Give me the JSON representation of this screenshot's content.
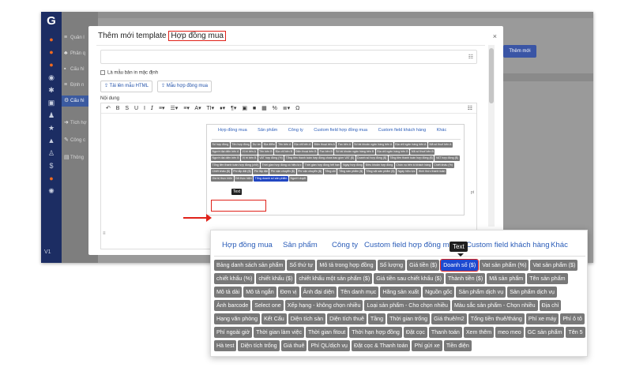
{
  "colors": {
    "accent": "#2146c2",
    "highlight": "#e0221a",
    "chip": "#787878",
    "nav": "#1c2d63"
  },
  "nav": {
    "logo": "G",
    "version": "V1"
  },
  "sidebar": {
    "items": [
      {
        "icon": "≡",
        "label": "Quản l"
      },
      {
        "icon": "♣",
        "label": "Phân q"
      },
      {
        "icon": "▪",
        "label": "Cấu hì"
      },
      {
        "icon": "≡",
        "label": "Định n"
      },
      {
        "icon": "⚙",
        "label": "Cấu hì"
      },
      {
        "icon": "➜",
        "label": "Tích hợ"
      },
      {
        "icon": "✎",
        "label": "Công c"
      },
      {
        "icon": "▤",
        "label": "Thông"
      }
    ]
  },
  "background": {
    "add_button": "Thêm mới"
  },
  "modal": {
    "title_prefix": "Thêm mới template",
    "title_highlight": "Hợp đồng mua",
    "close": "×",
    "checkbox_label": "Là mẫu bản in mặc định",
    "upload_html": "Tải lên mẫu HTML",
    "contract_template": "Mẫu hợp đồng mua",
    "content_label": "Nội dung",
    "toolbar": "↶ B S U I 𝘐 ≡▾ ☰▾ ≡▾ A▾ TI▾ ♦▾ ¶▾ ▣ ■ ▦ % ≣▾ Ω",
    "toolbar_right": "☷",
    "editor_right": "pt"
  },
  "tabs": [
    "Hợp đồng mua",
    "Sản phẩm",
    "Công ty",
    "Custom field hợp đồng mua",
    "Custom field khách hàng",
    "Khác"
  ],
  "small_chips": [
    "Số hợp đồng",
    "Tên hợp đồng",
    "Dự án",
    "Địa điểm",
    "Tên bên A",
    "Địa chỉ bên A",
    "Điện thoại bên A",
    "Fax bên A",
    "Số tài khoản ngân hàng bên A",
    "Địa chỉ ngân hàng bên A",
    "Mã số thuế bên A",
    "Người đại diện bên A",
    "Vị trí bên A",
    "Tên bên B",
    "Địa chỉ bên B",
    "Điện thoại bên B",
    "Fax bên B",
    "Số tài khoản ngân hàng bên B",
    "Địa chỉ ngân hàng bên B",
    "Mã số thuế bên B",
    "Người đại diện bên B",
    "Vị trí bên B",
    "VAT hợp đồng (%)",
    "Tổng tiền thanh toán hợp đồng chưa bao gồm VAT ($)",
    "Doanh số hợp đồng ($)",
    "Tổng tiền thanh toán hợp đồng ($)",
    "VAT hợp đồng ($)",
    "Tổng tiền thanh toán hợp đồng (chữ)",
    "Thời gian hợp đồng có hiệu lực",
    "Thời gian hợp đồng hết hạn",
    "Ngày hợp đồng",
    "Điều khoản hợp đồng",
    "Chức vụ bên kí khách hàng",
    "Chiết khấu (%)",
    "Chiết khấu ($)",
    "Phí lắp đặt ($)",
    "Phí lắp đặt",
    "Phí vận chuyển ($)",
    "Phí vận chuyển ($)",
    "Tổng chi",
    "Tổng sản phẩm ($)",
    "Tổng vật sản phẩm ($)",
    "Ngày hiệu lực",
    "Hình thức thanh toán",
    "Giá trị thực hiện",
    "Đã thực hiện",
    "Tổng doanh số sản phẩm",
    "Người duyệt"
  ],
  "small_tooltip": "Text",
  "zoom_chips": [
    "Bảng danh sách sản phẩm",
    "Số thứ tự",
    "Mô tả trong hợp đồng",
    "Số lượng",
    "Giá tiền ($)",
    "Doanh số ($)",
    "Vat sản phẩm (%)",
    "Vat sản phẩm ($)",
    "chiết khấu (%)",
    "chiết khấu ($)",
    "chiết khấu một sản phẩm ($)",
    "Giá tiền sau chiết khấu ($)",
    "Thành tiền ($)",
    "Mã sản phẩm",
    "Tên sản phẩm",
    "Mô tả dài",
    "Mô tả ngắn",
    "Đơn vị",
    "Ảnh đại diện",
    "Tên danh mục",
    "Hãng sản xuất",
    "Nguồn gốc",
    "Sản phẩm dịch vụ",
    "Sản phẩm dịch vụ",
    "Ảnh barcode",
    "Select one",
    "Xếp hạng - không chọn nhiều",
    "Loại sản phẩm - Cho chọn nhiều",
    "Màu sắc sản phẩm - Chọn nhiều",
    "Địa chỉ",
    "Hạng văn phòng",
    "Kết Cấu",
    "Diện tích sàn",
    "Diện tích thuê",
    "Tầng",
    "Thời gian trống",
    "Giá thuê/m2",
    "Tổng tiền thuê/tháng",
    "Phí xe máy",
    "Phí ô tô",
    "Phí ngoài giờ",
    "Thời gian làm việc",
    "Thời gian fitout",
    "Thời hạn hợp đồng",
    "Đặt cọc",
    "Thanh toán",
    "Xem thêm",
    "meo meo",
    "GC sản phẩm",
    "Tên 5",
    "Hà test",
    "Diện tích trống",
    "Giá thuê",
    "Phí QL/dịch vụ",
    "Đặt cọc & Thanh toán",
    "Phí gửi xe",
    "Tiền điện"
  ],
  "zoom_tooltip": "Text"
}
